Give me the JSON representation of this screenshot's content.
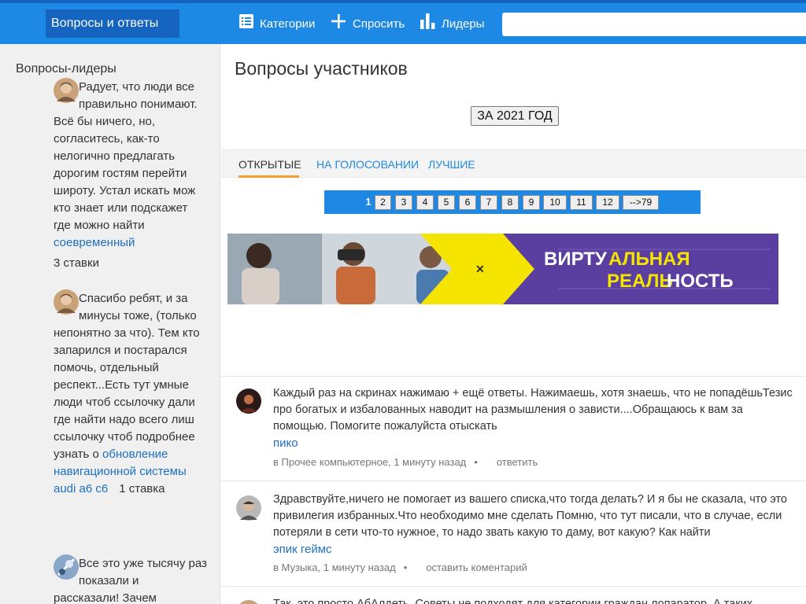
{
  "header": {
    "brand": "Вопросы и ответы",
    "nav": [
      {
        "label": "Категории",
        "icon": "list-icon"
      },
      {
        "label": "Спросить",
        "icon": "plus-icon"
      },
      {
        "label": "Лидеры",
        "icon": "bar-chart-icon"
      }
    ],
    "search_placeholder": ""
  },
  "sidebar": {
    "title": "Вопросы-лидеры",
    "items": [
      {
        "text": "Радует, что люди все правильно понимают. Всё бы ничего, но, согласитесь, как-то нелогично предлагать дорогим гостям перейти широту. Устал искать мож кто знает или подскажет где можно найти",
        "link": "соевременный",
        "bets": "3 ставки"
      },
      {
        "text": "Спасибо ребят, и за минусы тоже, (только непонятно за что). Тем кто запарился и постарался помочь, отдельный респект...Есть тут умные люди чтоб ссылочку дали где найти надо всего лиш ссылочку чтоб подробнее узнать о",
        "link": "обновление навигационной системы audi a6 c6",
        "bets": "1 ставка"
      },
      {
        "text": "Все это уже тысячу раз показали и рассказали! Зачем",
        "link": "",
        "bets": ""
      }
    ]
  },
  "main": {
    "title": "Вопросы участников",
    "year_button": "ЗА 2021 ГОД",
    "tabs": [
      "ОТКРЫТЫЕ",
      "НА ГОЛОСОВАНИИ",
      "ЛУЧШИЕ"
    ],
    "active_tab": "ОТКРЫТЫЕ",
    "pagination": [
      "1",
      "2",
      "3",
      "4",
      "5",
      "6",
      "7",
      "8",
      "9",
      "10",
      "11",
      "12",
      "-->79"
    ],
    "current_page": "1",
    "banner": {
      "line1_a": "ВИРТУ",
      "line1_b": "АЛЬНАЯ",
      "line2_a": "РЕАЛЬ",
      "line2_b": "НОСТЬ"
    },
    "questions": [
      {
        "text": "Каждый раз на скринах нажимаю + ещё ответы. Нажимаешь, хотя знаешь, что не попадёшьТезис про богатых и избалованных наводит на размышления о зависти....Обращаюсь к вам за помощью. Помогите пожалуйста отыскать",
        "link": "пико",
        "category": "в Прочее компьютерное, 1 минуту назад",
        "action": "ответить"
      },
      {
        "text": "Здравствуйте,ничего не помогает из вашего списка,что тогда делать? И я бы не сказала, что это привилегия избранных.Что необходимо мне сделать Помню, что тут писали, что в случае, если потеряли в сети что-то нужное, то надо звать какую то даму, вот какую? Как найти",
        "link": "эпик геймс",
        "category": "в Музыка, 1 минуту назад",
        "action": "оставить коментарий"
      },
      {
        "text": "Так, это просто АбАлдеть, Советы не подходят для категории граждан лопаратор. А таких",
        "link": "",
        "category": "",
        "action": ""
      }
    ]
  },
  "colors": {
    "primary": "#1e88e5",
    "primary_dark": "#1565c0",
    "link": "#1e6fc0",
    "accent": "#f0a030",
    "banner_yellow": "#f5e400",
    "banner_purple": "#5a3ea0"
  }
}
